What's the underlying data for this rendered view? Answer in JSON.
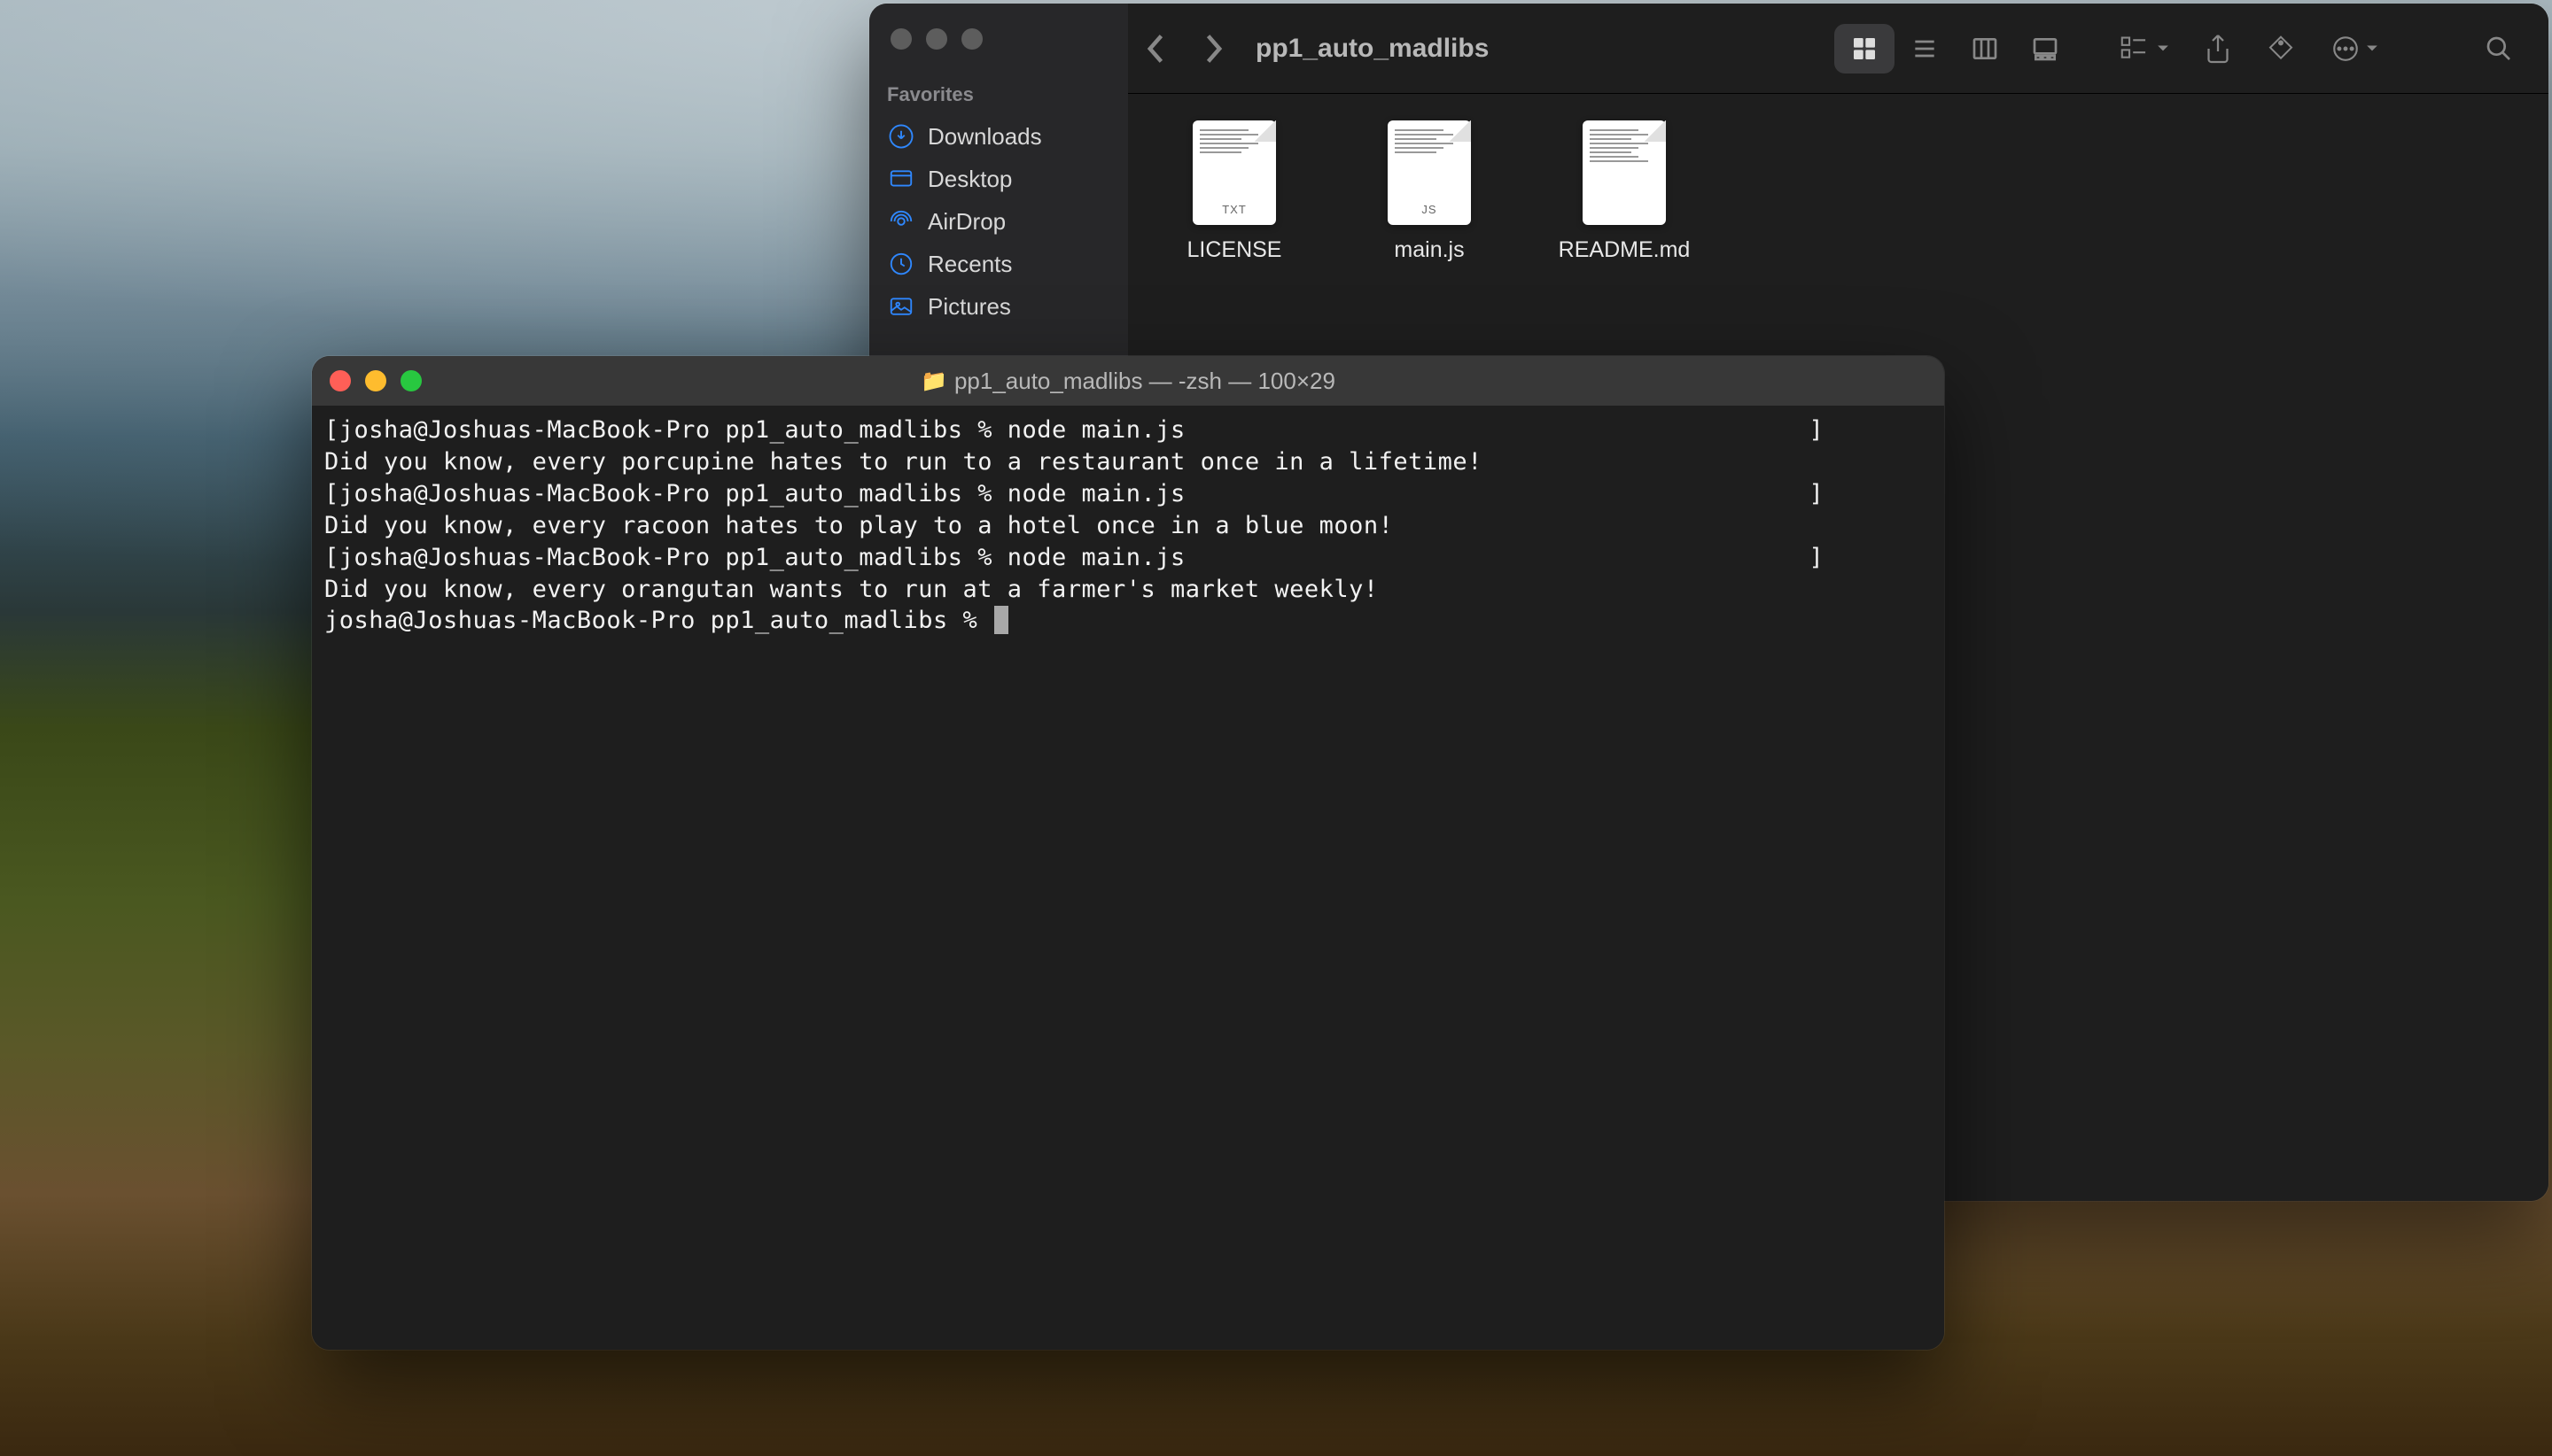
{
  "finder": {
    "title": "pp1_auto_madlibs",
    "sidebar": {
      "section_title": "Favorites",
      "items": [
        {
          "label": "Downloads",
          "icon": "download"
        },
        {
          "label": "Desktop",
          "icon": "desktop"
        },
        {
          "label": "AirDrop",
          "icon": "airdrop"
        },
        {
          "label": "Recents",
          "icon": "recents"
        },
        {
          "label": "Pictures",
          "icon": "pictures"
        }
      ]
    },
    "files": [
      {
        "name": "LICENSE",
        "badge": "TXT"
      },
      {
        "name": "main.js",
        "badge": "JS"
      },
      {
        "name": "README.md",
        "badge": ""
      }
    ]
  },
  "terminal": {
    "title": "pp1_auto_madlibs — -zsh — 100×29",
    "lines": [
      "[josha@Joshuas-MacBook-Pro pp1_auto_madlibs % node main.js                                          ]",
      "Did you know, every porcupine hates to run to a restaurant once in a lifetime!",
      "[josha@Joshuas-MacBook-Pro pp1_auto_madlibs % node main.js                                          ]",
      "Did you know, every racoon hates to play to a hotel once in a blue moon!",
      "[josha@Joshuas-MacBook-Pro pp1_auto_madlibs % node main.js                                          ]",
      "Did you know, every orangutan wants to run at a farmer's market weekly!"
    ],
    "prompt": "josha@Joshuas-MacBook-Pro pp1_auto_madlibs % "
  }
}
